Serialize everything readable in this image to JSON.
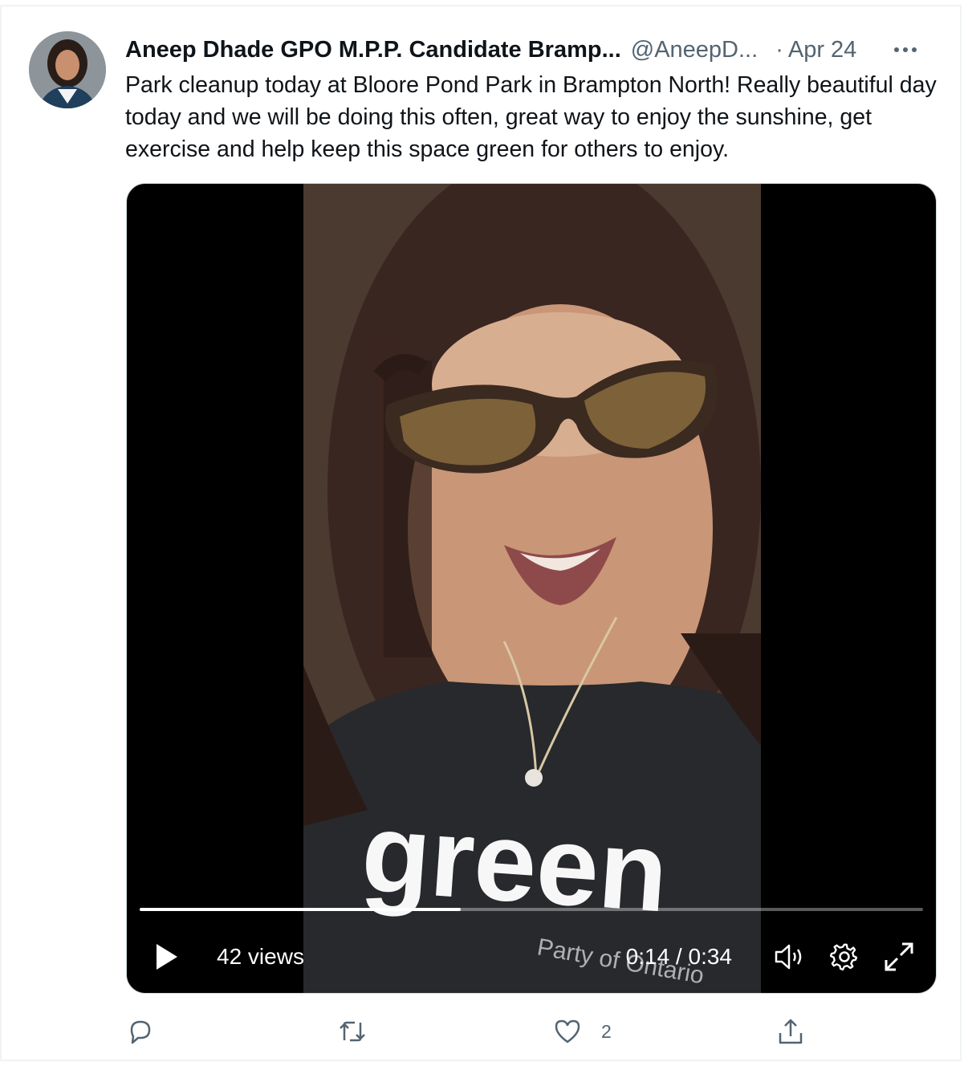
{
  "tweet": {
    "author_name": "Aneep Dhade GPO M.P.P. Candidate Bramp...",
    "handle": "@AneepD...",
    "separator": "·",
    "date": "Apr 24",
    "text": "Park cleanup today at Bloore Pond Park in Brampton North! Really beautiful day today and we will be doing this often, great way to enjoy the sunshine, get exercise and help keep this space green for others to enjoy.",
    "more_icon": "more-horizontal-icon"
  },
  "video": {
    "views": "42 views",
    "time": "0:14 / 0:34",
    "progress": 0.41,
    "shirt_text": "green",
    "shirt_subtext": "Party of Ontario"
  },
  "actions": {
    "reply_count": "",
    "retweet_count": "",
    "like_count": "2",
    "share_count": ""
  },
  "colors": {
    "text_primary": "#0f1419",
    "text_secondary": "#536471",
    "border": "#eff3f4"
  }
}
